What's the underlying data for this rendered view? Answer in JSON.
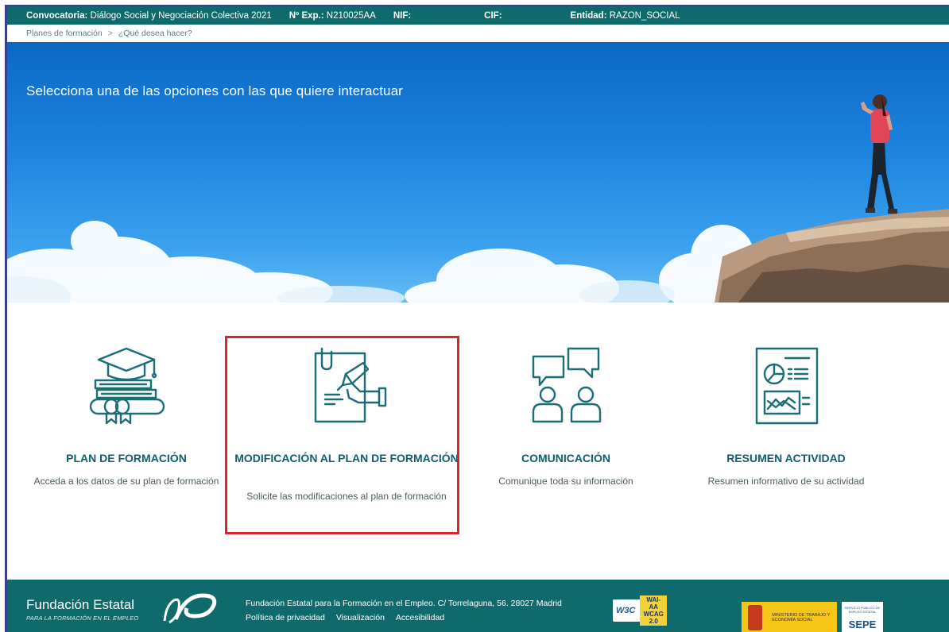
{
  "topbar": {
    "convocatoria_label": "Convocatoria:",
    "convocatoria_value": "Diálogo Social y Negociación Colectiva 2021",
    "exp_label": "Nº Exp.:",
    "exp_value": "N210025AA",
    "nif_label": "NIF:",
    "cif_label": "CIF:",
    "entidad_label": "Entidad:",
    "entidad_value": "RAZON_SOCIAL"
  },
  "breadcrumb": {
    "items": [
      "Planes de formación",
      "¿Qué desea hacer?"
    ],
    "separator": ">"
  },
  "hero": {
    "title": "Selecciona una de las opciones con las que quiere interactuar"
  },
  "options": [
    {
      "title": "PLAN DE FORMACIÓN",
      "description": "Acceda a los datos de su plan de formación",
      "icon": "graduation-cap-books-icon"
    },
    {
      "title": "MODIFICACIÓN AL PLAN DE FORMACIÓN",
      "description": "Solicite las modificaciones al plan de formación",
      "icon": "document-signing-icon"
    },
    {
      "title": "COMUNICACIÓN",
      "description": "Comunique toda su información",
      "icon": "people-chat-icon"
    },
    {
      "title": "RESUMEN ACTIVIDAD",
      "description": "Resumen informativo de su actividad",
      "icon": "report-chart-icon"
    }
  ],
  "footer": {
    "brand": "Fundación Estatal",
    "brand_sub": "PARA LA FORMACIÓN EN EL EMPLEO",
    "address": "Fundación Estatal para la Formación en el Empleo. C/ Torrelaguna, 56. 28027 Madrid",
    "links": [
      "Política de privacidad",
      "Visualización",
      "Accesibilidad"
    ],
    "w3c_badge": {
      "w3c": "W3C",
      "level": "WAI-AA",
      "version": "WCAG 2.0"
    },
    "ministry": "MINISTERIO DE TRABAJO Y ECONOMÍA SOCIAL",
    "sepe_sub": "SERVICIO PÚBLICO DE EMPLEO ESTATAL",
    "sepe": "SEPE"
  },
  "colors": {
    "header_bg": "#0f6b6b",
    "accent_text": "#0f5e6e",
    "highlight": "#d9232d",
    "sky": "#1f86e0"
  }
}
